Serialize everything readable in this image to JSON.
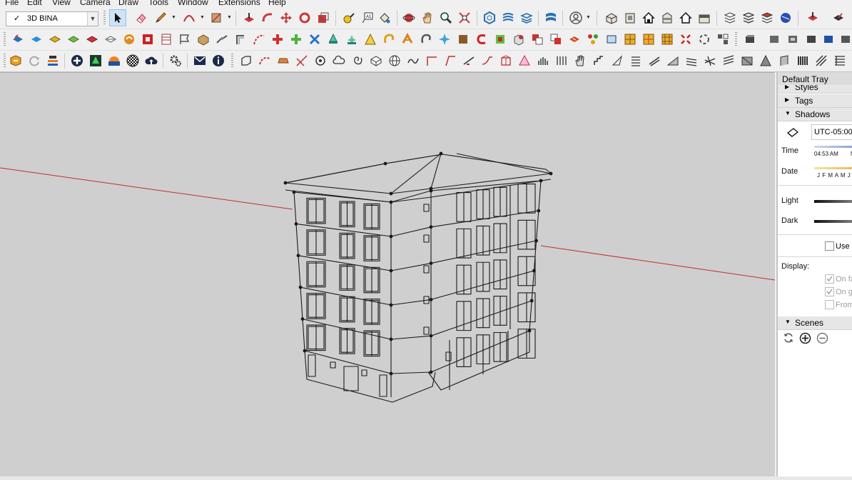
{
  "menu": [
    "File",
    "Edit",
    "View",
    "Camera",
    "Draw",
    "Tools",
    "Window",
    "Extensions",
    "Help"
  ],
  "tag_selector": {
    "checked": "✓",
    "value": "3D BINA"
  },
  "icons": {
    "row1": [
      "select-arrow-icon",
      "eraser-icon",
      "pencil-line-icon",
      "arc-tool-icon",
      "rectangle-shape-icon",
      "push-pull-icon",
      "follow-me-icon",
      "move-icon",
      "rotate-icon",
      "scale-icon",
      "tape-measure-icon",
      "text-label-icon",
      "paint-bucket-icon",
      "orbit-icon",
      "pan-hand-icon",
      "zoom-icon",
      "zoom-extents-icon",
      "3d-warehouse-icon",
      "extension-warehouse-icon",
      "layer-manager-icon",
      "sandbox-icon",
      "user-account-icon",
      "iso-view-icon",
      "front-view-icon",
      "home-view-icon",
      "right-view-icon",
      "back-view-icon",
      "left-view-icon",
      "xray-style-icon",
      "wireframe-style-icon",
      "hidden-line-style-icon",
      "shaded-style-icon",
      "section-plane-icon",
      "section-display-icon"
    ],
    "row2": [
      "sandbox-smoove-icon",
      "sandbox-stamp-icon",
      "sandbox-drape-icon",
      "sandbox-add-detail-icon",
      "sandbox-flip-edge-icon",
      "curve-icon",
      "solid-union-icon",
      "solid-subtract-icon",
      "trim-icon",
      "split-icon",
      "cube-outline-icon",
      "spline-icon",
      "joint-push-pull-icon",
      "flip-icon",
      "vertex-tools-icon",
      "warning-cone-icon",
      "round-corner-icon",
      "ropes-icon",
      "noodle-icon",
      "bezier-icon",
      "extrude-icon",
      "loop-icon",
      "component-icon",
      "fredo-scale-icon",
      "curviloft-icon",
      "weld-icon",
      "shape-bender-icon",
      "box-array-icon",
      "grid-hatch-icon",
      "grid-square-icon",
      "close-x-icon",
      "selection-toys-icon",
      "flatten-icon",
      "profile-builder-icon",
      "layer-tools-icon",
      "house-builder-icon"
    ],
    "row3": [
      "layout-send-icon",
      "refresh-icon",
      "stack-icon",
      "add-circle-icon",
      "tree-icon",
      "sun-shade-icon",
      "checker-material-icon",
      "cloud-upload-icon",
      "settings-gears-icon",
      "mail-icon",
      "info-icon",
      "hinge-icon",
      "dash-curve-icon",
      "cone-icon",
      "bisect-icon",
      "oval-icon",
      "cloud-shape-icon",
      "spiral-icon",
      "box-3d-icon",
      "globe-icon",
      "wave-icon",
      "offset-line-icon",
      "angle-line-icon",
      "slope-icon",
      "hook-icon",
      "frame-icon",
      "triangle-icon",
      "column-icon",
      "grid-cell-icon",
      "hand-icon",
      "stair-icon",
      "face-icon",
      "fan-icon",
      "fence-icon",
      "ramp-icon",
      "slash-icon",
      "mesh-icon",
      "bridge-icon",
      "zigzag-icon",
      "block-icon",
      "hatch-icon",
      "curve-wall-icon",
      "pillar-icon",
      "lattice-icon",
      "roof-icon"
    ]
  },
  "tray": {
    "title": "Default Tray",
    "sections": {
      "styles": "Styles",
      "tags": "Tags",
      "shadows": "Shadows",
      "scenes": "Scenes"
    },
    "shadows": {
      "timezone": "UTC-05:00",
      "time_label": "Time",
      "time_value": "04:53 AM",
      "time_extra": "N",
      "date_label": "Date",
      "months": "J F M A M J",
      "light_label": "Light",
      "dark_label": "Dark",
      "use_sun": "Use s",
      "display_label": "Display:",
      "on_faces": "On fa",
      "on_ground": "On gr",
      "from_edges": "From"
    }
  },
  "colors": {
    "viewport_bg": "#cfcfcf",
    "axis_red": "#c0302a",
    "tray_header": "#e6e6e6"
  }
}
